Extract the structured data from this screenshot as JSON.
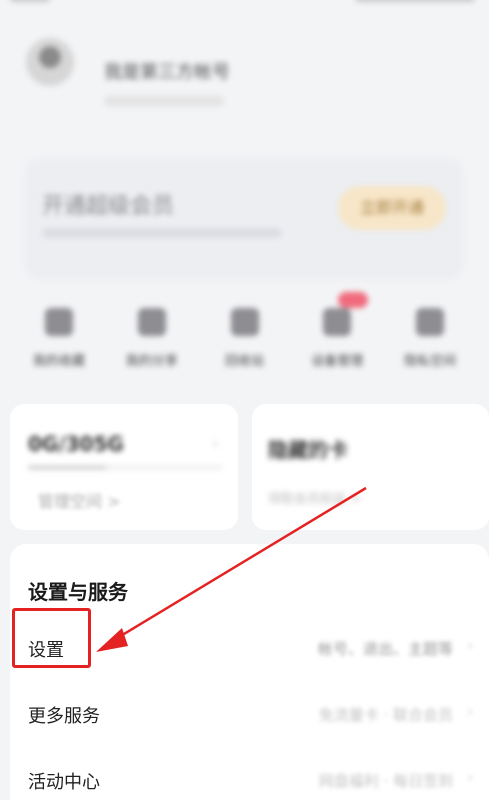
{
  "profile": {
    "nickname": "我是第三方帐号"
  },
  "vip": {
    "title": "开通超级会员",
    "button": "立即开通"
  },
  "shortcuts": [
    {
      "label": "我的收藏",
      "icon": "star-icon"
    },
    {
      "label": "我的分享",
      "icon": "share-icon"
    },
    {
      "label": "回收站",
      "icon": "trash-icon"
    },
    {
      "label": "设备管理",
      "icon": "device-icon",
      "badge": true
    },
    {
      "label": "隐私空间",
      "icon": "lock-box-icon"
    }
  ],
  "storage": {
    "value": "0G/305G",
    "manage_label": "管理空间 >"
  },
  "side_card": {
    "title": "隐藏的卡",
    "subtitle": "领取会员权益  >"
  },
  "settings_section": {
    "title": "设置与服务",
    "rows": [
      {
        "label": "设置",
        "desc": "帐号、退出、主题等",
        "chevron": "›"
      },
      {
        "label": "更多服务",
        "desc": "免流量卡 · 联合会员",
        "chevron": "›"
      },
      {
        "label": "活动中心",
        "desc": "网盘福利 · 每日签到",
        "chevron": "›"
      }
    ]
  },
  "annotation": {
    "color": "#e52222"
  }
}
